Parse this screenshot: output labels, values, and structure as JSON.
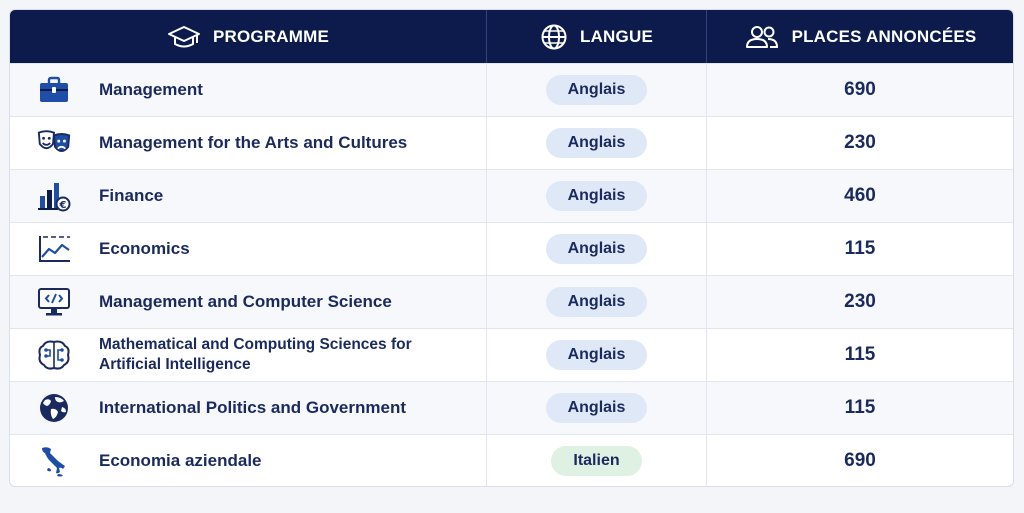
{
  "header": {
    "programme": "PROGRAMME",
    "langue": "LANGUE",
    "places": "PLACES ANNONCÉES"
  },
  "colors": {
    "header_bg": "#0d1b4c",
    "text": "#1b2a5e",
    "badge_english": "#dfe8f6",
    "badge_italian": "#dff1e2"
  },
  "rows": [
    {
      "icon": "briefcase-icon",
      "programme": "Management",
      "langue": "Anglais",
      "places": "690"
    },
    {
      "icon": "theater-masks-icon",
      "programme": "Management for the Arts and Cultures",
      "langue": "Anglais",
      "places": "230"
    },
    {
      "icon": "finance-chart-euro-icon",
      "programme": "Finance",
      "langue": "Anglais",
      "places": "460"
    },
    {
      "icon": "line-chart-icon",
      "programme": "Economics",
      "langue": "Anglais",
      "places": "115"
    },
    {
      "icon": "code-monitor-icon",
      "programme": "Management and Computer Science",
      "langue": "Anglais",
      "places": "230"
    },
    {
      "icon": "brain-circuit-icon",
      "programme_line1": "Mathematical and Computing Sciences for",
      "programme_line2": "Artificial Intelligence",
      "langue": "Anglais",
      "places": "115"
    },
    {
      "icon": "globe-icon",
      "programme": "International Politics and Government",
      "langue": "Anglais",
      "places": "115"
    },
    {
      "icon": "italy-map-icon",
      "programme": "Economia aziendale",
      "langue": "Italien",
      "places": "690"
    }
  ]
}
